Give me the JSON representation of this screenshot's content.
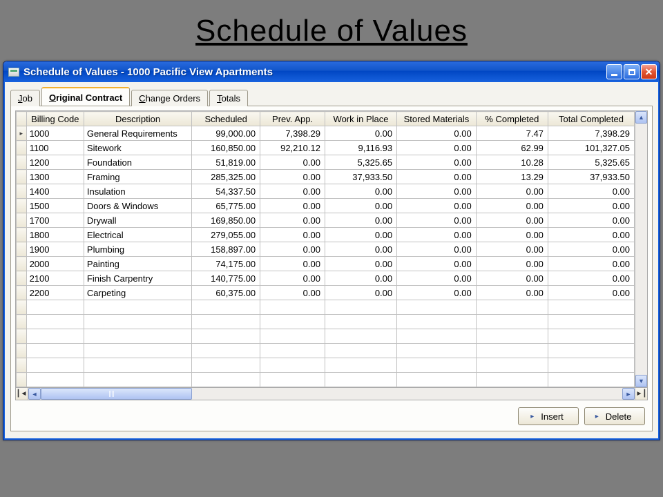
{
  "slide": {
    "title": "Schedule of Values"
  },
  "window": {
    "title": "Schedule of Values - 1000   Pacific View Apartments"
  },
  "tabs": {
    "job": "Job",
    "original_contract": "Original Contract",
    "change_orders": "Change Orders",
    "totals": "Totals",
    "active": "original_contract"
  },
  "columns": {
    "billing_code": "Billing Code",
    "description": "Description",
    "scheduled": "Scheduled",
    "prev_app": "Prev. App.",
    "work_in_place": "Work in Place",
    "stored_materials": "Stored Materials",
    "pct_completed": "% Completed",
    "total_completed": "Total Completed"
  },
  "rows": [
    {
      "code": "1000",
      "desc": "General Requirements",
      "scheduled": "99,000.00",
      "prev": "7,398.29",
      "wip": "0.00",
      "stored": "0.00",
      "pct": "7.47",
      "total": "7,398.29"
    },
    {
      "code": "1100",
      "desc": "Sitework",
      "scheduled": "160,850.00",
      "prev": "92,210.12",
      "wip": "9,116.93",
      "stored": "0.00",
      "pct": "62.99",
      "total": "101,327.05"
    },
    {
      "code": "1200",
      "desc": "Foundation",
      "scheduled": "51,819.00",
      "prev": "0.00",
      "wip": "5,325.65",
      "stored": "0.00",
      "pct": "10.28",
      "total": "5,325.65"
    },
    {
      "code": "1300",
      "desc": "Framing",
      "scheduled": "285,325.00",
      "prev": "0.00",
      "wip": "37,933.50",
      "stored": "0.00",
      "pct": "13.29",
      "total": "37,933.50"
    },
    {
      "code": "1400",
      "desc": "Insulation",
      "scheduled": "54,337.50",
      "prev": "0.00",
      "wip": "0.00",
      "stored": "0.00",
      "pct": "0.00",
      "total": "0.00"
    },
    {
      "code": "1500",
      "desc": "Doors & Windows",
      "scheduled": "65,775.00",
      "prev": "0.00",
      "wip": "0.00",
      "stored": "0.00",
      "pct": "0.00",
      "total": "0.00"
    },
    {
      "code": "1700",
      "desc": "Drywall",
      "scheduled": "169,850.00",
      "prev": "0.00",
      "wip": "0.00",
      "stored": "0.00",
      "pct": "0.00",
      "total": "0.00"
    },
    {
      "code": "1800",
      "desc": "Electrical",
      "scheduled": "279,055.00",
      "prev": "0.00",
      "wip": "0.00",
      "stored": "0.00",
      "pct": "0.00",
      "total": "0.00"
    },
    {
      "code": "1900",
      "desc": "Plumbing",
      "scheduled": "158,897.00",
      "prev": "0.00",
      "wip": "0.00",
      "stored": "0.00",
      "pct": "0.00",
      "total": "0.00"
    },
    {
      "code": "2000",
      "desc": "Painting",
      "scheduled": "74,175.00",
      "prev": "0.00",
      "wip": "0.00",
      "stored": "0.00",
      "pct": "0.00",
      "total": "0.00"
    },
    {
      "code": "2100",
      "desc": "Finish Carpentry",
      "scheduled": "140,775.00",
      "prev": "0.00",
      "wip": "0.00",
      "stored": "0.00",
      "pct": "0.00",
      "total": "0.00"
    },
    {
      "code": "2200",
      "desc": "Carpeting",
      "scheduled": "60,375.00",
      "prev": "0.00",
      "wip": "0.00",
      "stored": "0.00",
      "pct": "0.00",
      "total": "0.00"
    }
  ],
  "empty_row_count": 6,
  "buttons": {
    "insert": "Insert",
    "delete": "Delete"
  }
}
